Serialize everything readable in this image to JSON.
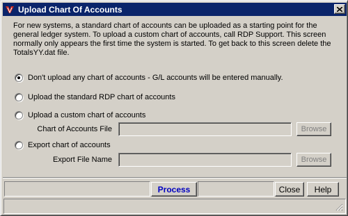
{
  "window": {
    "title": "Upload Chart Of Accounts",
    "app_icon": "rdp-logo-icon",
    "close_icon": "close-icon"
  },
  "intro_text": "For new systems, a standard chart of accounts can be uploaded as a starting point for the general ledger system.  To upload a custom chart of accounts, call RDP Support.  This screen normally only appears the first time the system is started.  To get back to this screen delete the TotalsYY.dat file.",
  "options": [
    {
      "label": "Don't upload any chart of accounts - G/L accounts will be entered manually.",
      "checked": true
    },
    {
      "label": "Upload the standard RDP chart of accounts",
      "checked": false
    },
    {
      "label": "Upload a custom chart of accounts",
      "checked": false
    },
    {
      "label": "Export chart of accounts",
      "checked": false
    }
  ],
  "custom_file": {
    "label": "Chart of Accounts File",
    "value": "",
    "browse_label": "Browse"
  },
  "export_file": {
    "label": "Export File Name",
    "value": "",
    "browse_label": "Browse"
  },
  "buttons": {
    "process": "Process",
    "close": "Close",
    "help": "Help"
  },
  "colors": {
    "title_bar": "#0a246a",
    "window_bg": "#d4d0c8",
    "process_text": "#0000c0",
    "disabled_text": "#808080"
  }
}
